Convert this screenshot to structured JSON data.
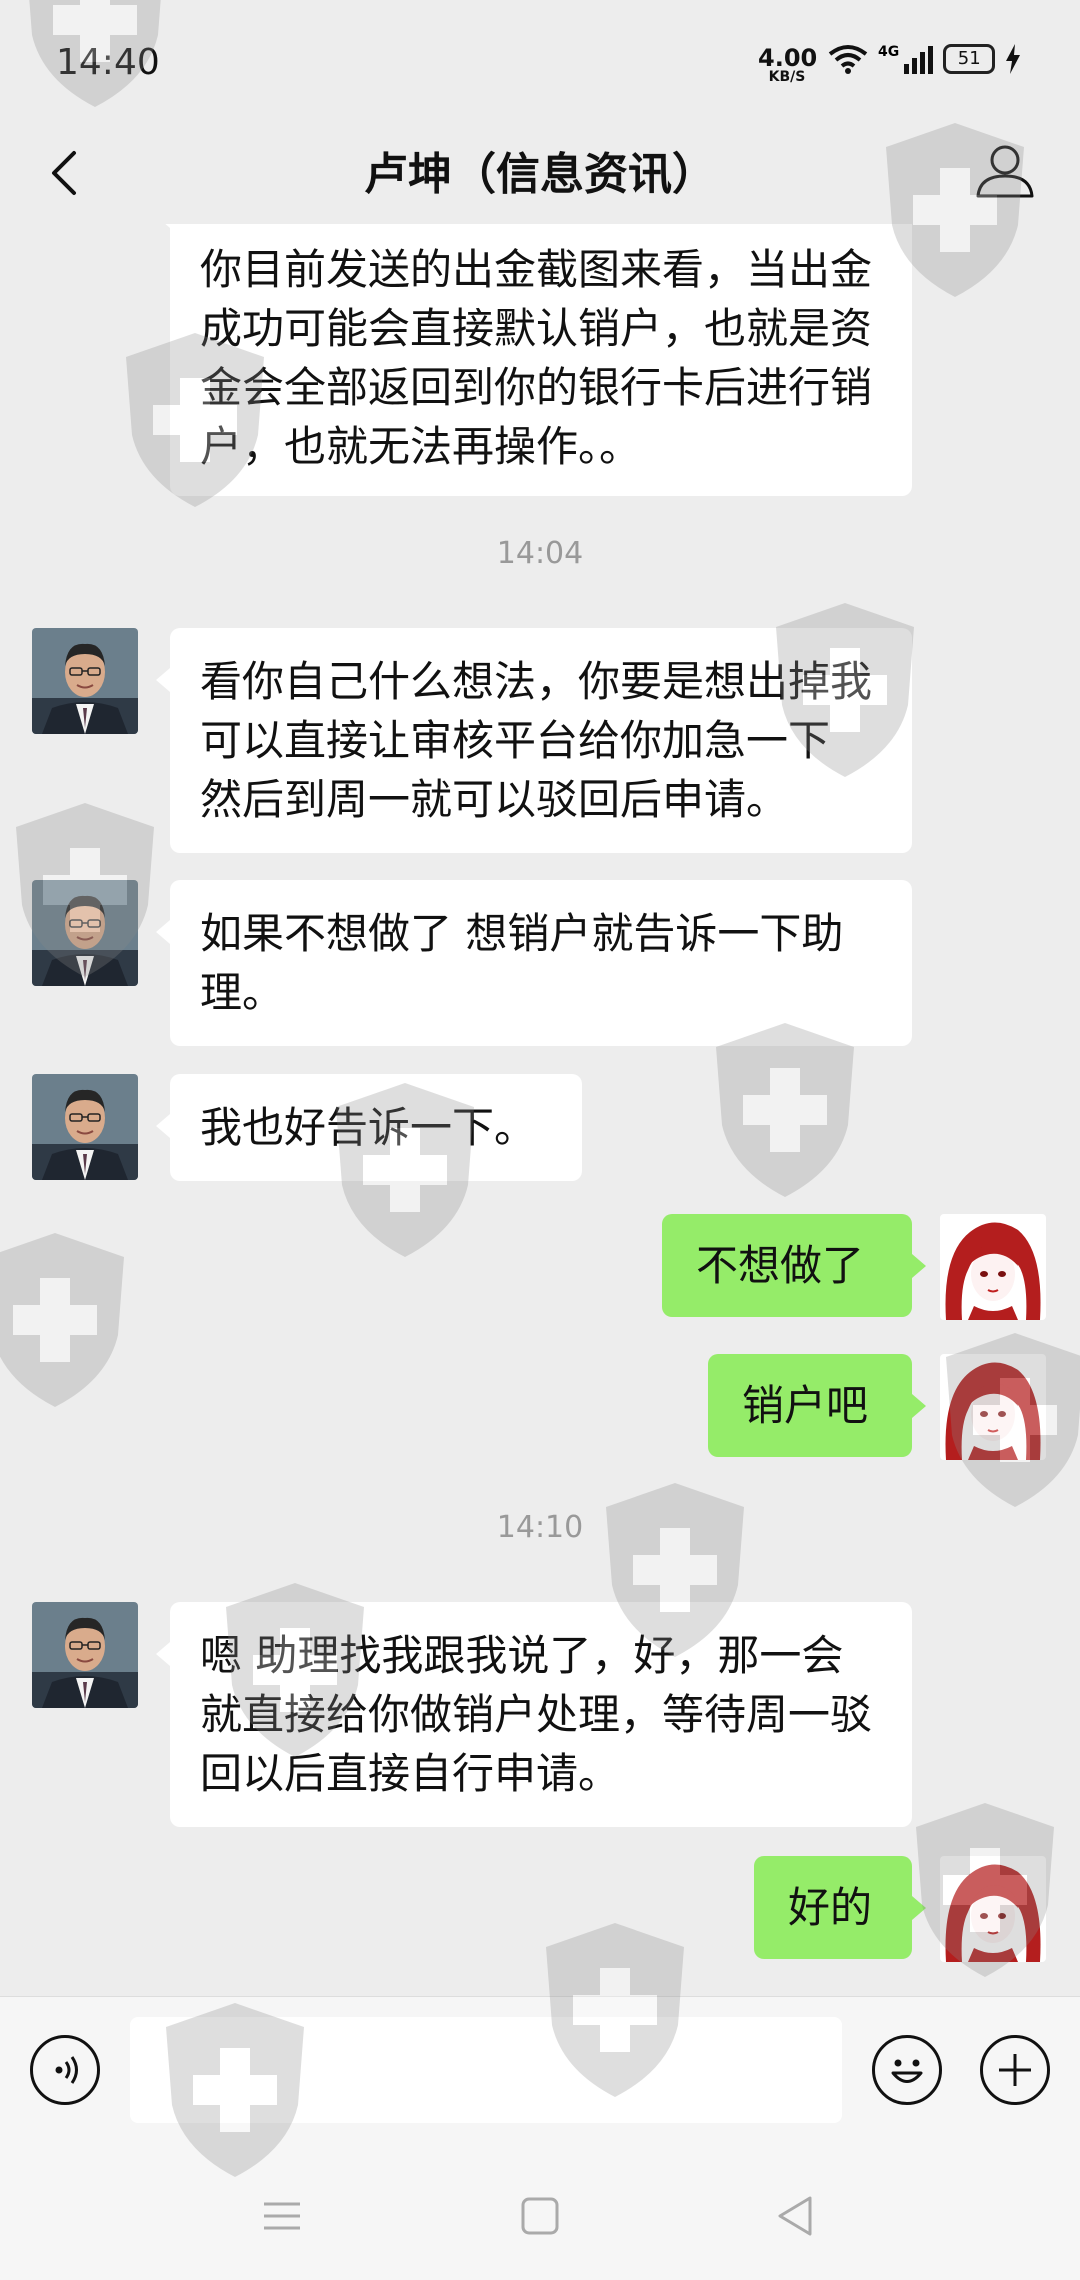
{
  "status_bar": {
    "time": "14:40",
    "net_speed_value": "4.00",
    "net_speed_unit": "KB/S",
    "signal_label": "4G",
    "battery_level": "51"
  },
  "header": {
    "title": "卢坤（信息资讯）",
    "back_icon": "chevron-left-icon",
    "profile_icon": "person-icon"
  },
  "messages": [
    {
      "side": "left",
      "text": "你目前发送的出金截图来看，当出金成功可能会直接默认销户，也就是资金会全部返回到你的银行卡后进行销户，也就无法再操作。。"
    },
    {
      "timestamp": "14:04"
    },
    {
      "side": "left",
      "text": "看你自己什么想法，你要是想出掉我可以直接让审核平台给你加急一下  然后到周一就可以驳回后申请。"
    },
    {
      "side": "left",
      "text": " 如果不想做了 想销户就告诉一下助理。"
    },
    {
      "side": "left",
      "text": "我也好告诉一下。"
    },
    {
      "side": "right",
      "text": "不想做了"
    },
    {
      "side": "right",
      "text": "销户吧"
    },
    {
      "timestamp": "14:10"
    },
    {
      "side": "left",
      "text": "嗯 助理找我跟我说了，好，那一会就直接给你做销户处理，等待周一驳回以后直接自行申请。"
    },
    {
      "side": "right",
      "text": "好的"
    }
  ],
  "input_bar": {
    "voice_icon": "voice-icon",
    "emoji_icon": "emoji-icon",
    "add_icon": "plus-icon"
  },
  "nav_bar": {
    "menu_icon": "menu-icon",
    "home_icon": "home-square-icon",
    "back_icon": "back-triangle-icon"
  },
  "colors": {
    "background": "#ededed",
    "bubble_sent": "#95ec69",
    "bubble_received": "#ffffff",
    "timestamp_text": "#999999"
  }
}
